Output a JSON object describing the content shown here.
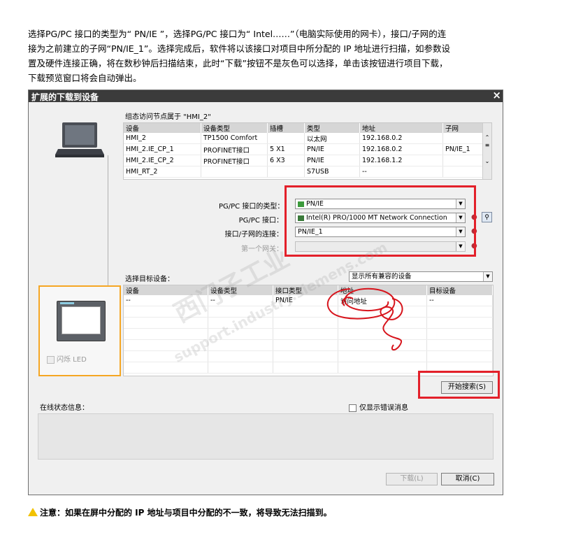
{
  "intro": [
    "选择PG/PC 接口的类型为“ PN/IE ”，选择PG/PC 接口为“ Intel……”（电脑实际使用的网卡），接口/子网的连",
    "接为之前建立的子网“PN/IE_1”。选择完成后，软件将以该接口对项目中所分配的 IP 地址进行扫描，如参数设",
    "置及硬件连接正确，将在数秒钟后扫描结束，此时“下载”按钮不是灰色可以选择，单击该按钮进行项目下载，",
    "下载预览窗口将会自动弹出。"
  ],
  "dialog": {
    "title": "扩展的下载到设备",
    "close": "×",
    "node_caption": "组态访问节点属于 \"HMI_2\"",
    "node_table": {
      "headers": [
        "设备",
        "设备类型",
        "插槽",
        "类型",
        "地址",
        "子网"
      ],
      "rows": [
        [
          "HMI_2",
          "TP1500 Comfort",
          "",
          "以太网",
          "192.168.0.2",
          ""
        ],
        [
          "HMI_2.IE_CP_1",
          "PROFINET接口",
          "5 X1",
          "PN/IE",
          "192.168.0.2",
          "PN/IE_1"
        ],
        [
          "HMI_2.IE_CP_2",
          "PROFINET接口",
          "6 X3",
          "PN/IE",
          "192.168.1.2",
          ""
        ],
        [
          "HMI_RT_2",
          "",
          "",
          "S7USB",
          "--",
          ""
        ]
      ]
    },
    "pgpc_type_label": "PG/PC 接口的类型：",
    "pgpc_type_value": "PN/IE",
    "pgpc_iface_label": "PG/PC 接口：",
    "pgpc_iface_value": "Intel(R) PRO/1000 MT Network Connection",
    "subnet_label": "接口/子网的连接：",
    "subnet_value": "PN/IE_1",
    "gateway_label": "第一个网关：",
    "gateway_value": "",
    "target_label": "选择目标设备：",
    "target_filter": "显示所有兼容的设备",
    "target_table": {
      "headers": [
        "设备",
        "设备类型",
        "接口类型",
        "地址",
        "目标设备"
      ],
      "rows": [
        [
          "--",
          "--",
          "PN/IE",
          "访问地址",
          "--"
        ]
      ]
    },
    "led_label": "闪烁 LED",
    "start_search": "开始搜索(S)",
    "status_label": "在线状态信息：",
    "errors_only": "仅显示错误消息",
    "download": "下载(L)",
    "cancel": "取消(C)"
  },
  "watermark": [
    "西门子工业",
    "support.industry.siemens.com"
  ],
  "warning": "注意：如果在屏中分配的 IP 地址与项目中分配的不一致，将导致无法扫描到。",
  "colors": {
    "highlight": "#e3202a",
    "selected_device": "#f5a623"
  }
}
